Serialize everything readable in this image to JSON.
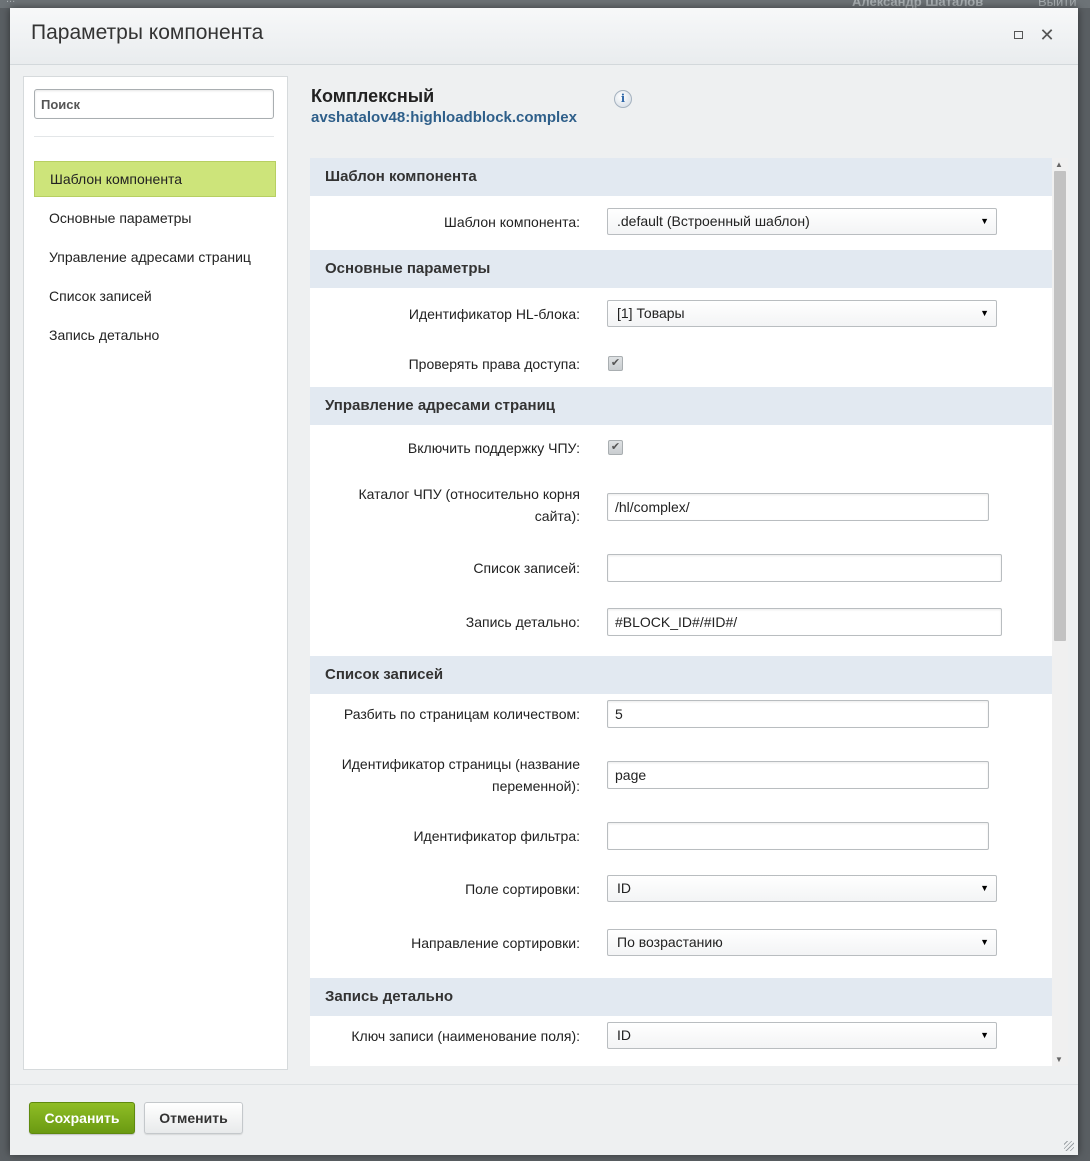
{
  "background": {
    "partial_text": "...",
    "user_name": "Александр Шаталов",
    "extra": "Выйти"
  },
  "dialog": {
    "title": "Параметры компонента"
  },
  "sidebar": {
    "search_placeholder": "Поиск",
    "items": [
      {
        "label": "Шаблон компонента",
        "active": true
      },
      {
        "label": "Основные параметры"
      },
      {
        "label": "Управление адресами страниц"
      },
      {
        "label": "Список записей"
      },
      {
        "label": "Запись детально"
      }
    ]
  },
  "component": {
    "title": "Комплексный",
    "code": "avshatalov48:highloadblock.complex"
  },
  "sections": {
    "template": {
      "header": "Шаблон компонента",
      "template_label": "Шаблон компонента:",
      "template_value": ".default (Встроенный шаблон)"
    },
    "main": {
      "header": "Основные параметры",
      "hl_label": "Идентификатор HL-блока:",
      "hl_value": "[1] Товары",
      "check_rights_label": "Проверять права доступа:",
      "check_rights_checked": true
    },
    "sef": {
      "header": "Управление адресами страниц",
      "enable_label": "Включить поддержку ЧПУ:",
      "enable_checked": true,
      "folder_label_1": "Каталог ЧПУ (относительно корня",
      "folder_label_2": "сайта):",
      "folder_value": "/hl/complex/",
      "list_label": "Список записей:",
      "list_value": "",
      "detail_label": "Запись детально:",
      "detail_value": "#BLOCK_ID#/#ID#/"
    },
    "list": {
      "header": "Список записей",
      "page_count_label": "Разбить по страницам количеством:",
      "page_count_value": "5",
      "page_id_label_1": "Идентификатор страницы (название",
      "page_id_label_2": "переменной):",
      "page_id_value": "page",
      "filter_label": "Идентификатор фильтра:",
      "filter_value": "",
      "sort_field_label": "Поле сортировки:",
      "sort_field_value": "ID",
      "sort_dir_label": "Направление сортировки:",
      "sort_dir_value": "По возрастанию"
    },
    "detail": {
      "header": "Запись детально",
      "key_label": "Ключ записи (наименование поля):",
      "key_value": "ID"
    }
  },
  "footer": {
    "save_label": "Сохранить",
    "cancel_label": "Отменить"
  },
  "colors": {
    "accent_green": "#7cab1a",
    "active_nav": "#cde47a",
    "section_bg": "#e2e9f1",
    "link_blue": "#2e5f8a"
  }
}
